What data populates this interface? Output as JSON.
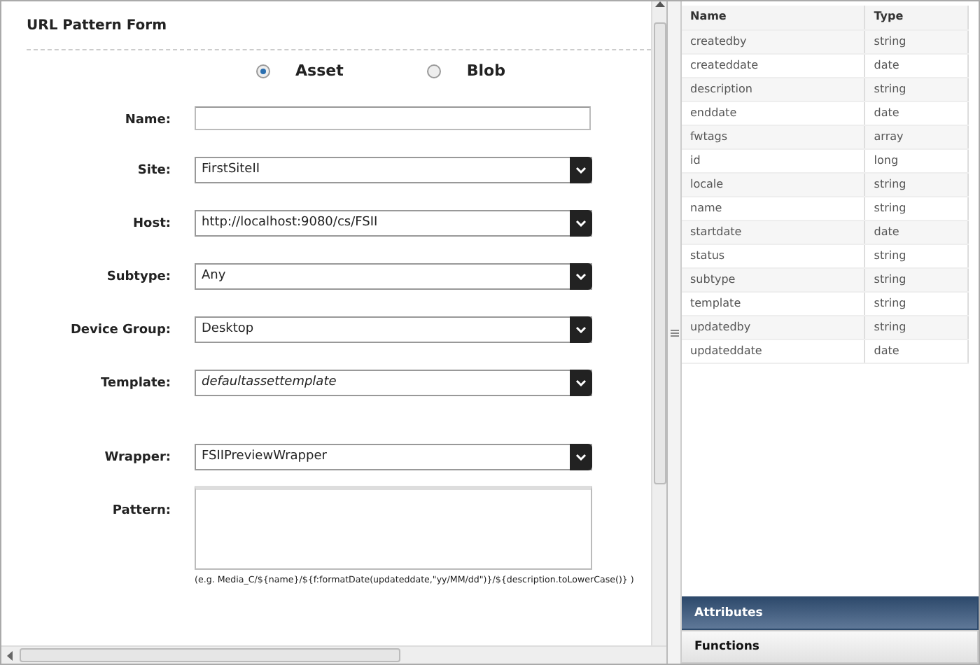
{
  "form": {
    "title": "URL Pattern Form",
    "types": [
      {
        "label": "Asset",
        "selected": true
      },
      {
        "label": "Blob",
        "selected": false
      }
    ],
    "fields": [
      {
        "label": "Name:",
        "kind": "text"
      },
      {
        "label": "Site:",
        "kind": "select",
        "value": "FirstSiteII"
      },
      {
        "label": "Host:",
        "kind": "select",
        "value": "http://localhost:9080/cs/FSII"
      },
      {
        "label": "Subtype:",
        "kind": "select",
        "value": "Any"
      },
      {
        "label": "Device Group:",
        "kind": "select",
        "value": "Desktop"
      },
      {
        "label": "Template:",
        "kind": "combo",
        "value": "defaultassettemplate"
      },
      {
        "label": "Wrapper:",
        "kind": "select",
        "value": "FSIIPreviewWrapper"
      },
      {
        "label": "Pattern:",
        "kind": "textarea"
      }
    ],
    "pattern_hint": "(e.g. Media_C/${name}/${f:formatDate(updateddate,\"yy/MM/dd\")}/${description.toLowerCase()} )"
  },
  "attributes_table": {
    "columns": [
      "Name",
      "Type"
    ],
    "rows": [
      [
        "createdby",
        "string"
      ],
      [
        "createddate",
        "date"
      ],
      [
        "description",
        "string"
      ],
      [
        "enddate",
        "date"
      ],
      [
        "fwtags",
        "array"
      ],
      [
        "id",
        "long"
      ],
      [
        "locale",
        "string"
      ],
      [
        "name",
        "string"
      ],
      [
        "startdate",
        "date"
      ],
      [
        "status",
        "string"
      ],
      [
        "subtype",
        "string"
      ],
      [
        "template",
        "string"
      ],
      [
        "updatedby",
        "string"
      ],
      [
        "updateddate",
        "date"
      ]
    ]
  },
  "panels": [
    {
      "label": "Attributes",
      "selected": true
    },
    {
      "label": "Functions",
      "selected": false
    }
  ]
}
